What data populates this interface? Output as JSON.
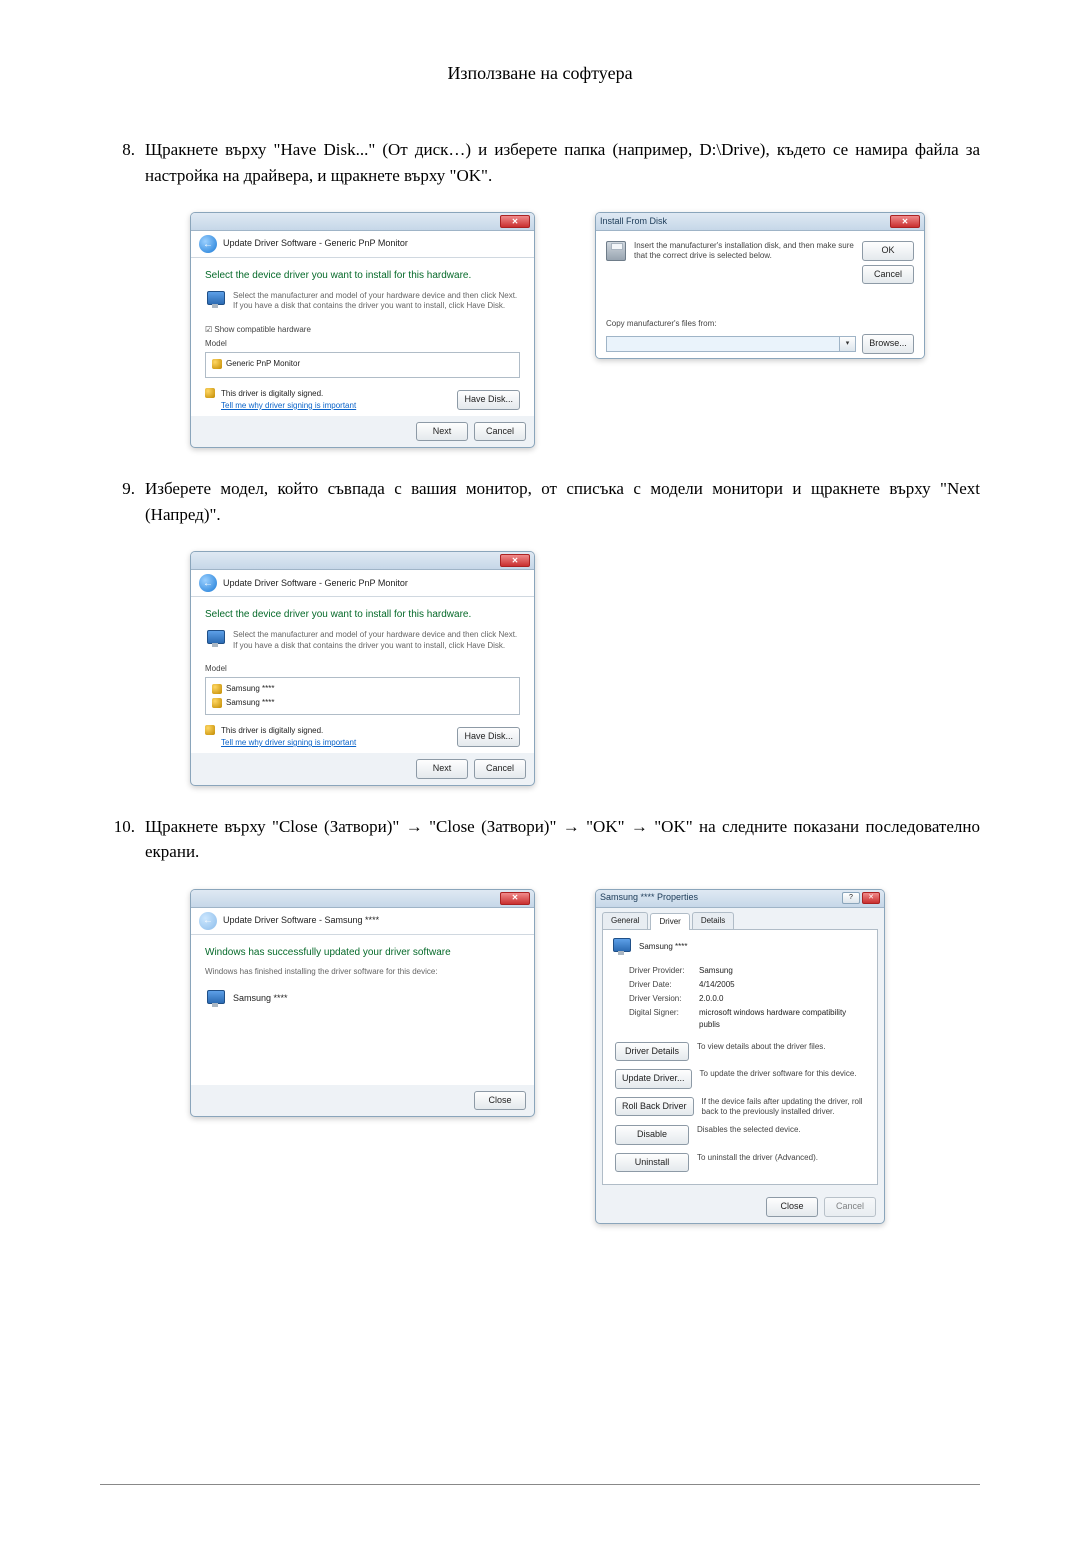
{
  "header": {
    "title": "Използване на софтуера"
  },
  "steps": {
    "s8": {
      "num": "8.",
      "text": "Щракнете върху \"Have Disk...\" (От диск…) и изберете папка (например, D:\\Drive), където се намира файла за настройка на драйвера, и щракнете върху \"OK\"."
    },
    "s9": {
      "num": "9.",
      "text": "Изберете модел, който съвпада с вашия монитор, от списъка с модели монитори и щракнете върху \"Next (Напред)\"."
    },
    "s10": {
      "num": "10.",
      "text": "Щракнете върху \"Close (Затвори)\" → \"Close (Затвори)\" → \"OK\" → \"OK\" на следните показани последователно екрани."
    }
  },
  "dlgA": {
    "breadcrumb": "Update Driver Software - Generic PnP Monitor",
    "heading": "Select the device driver you want to install for this hardware.",
    "info": "Select the manufacturer and model of your hardware device and then click Next. If you have a disk that contains the driver you want to install, click Have Disk.",
    "compat_label": "☑ Show compatible hardware",
    "list_label": "Model",
    "items": [
      "Generic PnP Monitor"
    ],
    "signed": "This driver is digitally signed.",
    "signed_link": "Tell me why driver signing is important",
    "have_disk": "Have Disk...",
    "next": "Next",
    "cancel": "Cancel"
  },
  "dlgB": {
    "title": "Install From Disk",
    "msg": "Insert the manufacturer's installation disk, and then make sure that the correct drive is selected below.",
    "ok": "OK",
    "cancel": "Cancel",
    "copy_label": "Copy manufacturer's files from:",
    "browse": "Browse..."
  },
  "dlgC": {
    "breadcrumb": "Update Driver Software - Generic PnP Monitor",
    "heading": "Select the device driver you want to install for this hardware.",
    "info": "Select the manufacturer and model of your hardware device and then click Next. If you have a disk that contains the driver you want to install, click Have Disk.",
    "list_label": "Model",
    "items": [
      "Samsung ****",
      "Samsung ****"
    ],
    "signed": "This driver is digitally signed.",
    "signed_link": "Tell me why driver signing is important",
    "have_disk": "Have Disk...",
    "next": "Next",
    "cancel": "Cancel"
  },
  "dlgD": {
    "breadcrumb": "Update Driver Software - Samsung ****",
    "heading": "Windows has successfully updated your driver software",
    "sub": "Windows has finished installing the driver software for this device:",
    "device": "Samsung ****",
    "close": "Close"
  },
  "dlgE": {
    "title": "Samsung **** Properties",
    "tabs": [
      "General",
      "Driver",
      "Details"
    ],
    "device": "Samsung ****",
    "provider_k": "Driver Provider:",
    "provider_v": "Samsung",
    "date_k": "Driver Date:",
    "date_v": "4/14/2005",
    "version_k": "Driver Version:",
    "version_v": "2.0.0.0",
    "signer_k": "Digital Signer:",
    "signer_v": "microsoft windows hardware compatibility publis",
    "btn_details": "Driver Details",
    "desc_details": "To view details about the driver files.",
    "btn_update": "Update Driver...",
    "desc_update": "To update the driver software for this device.",
    "btn_rollback": "Roll Back Driver",
    "desc_rollback": "If the device fails after updating the driver, roll back to the previously installed driver.",
    "btn_disable": "Disable",
    "desc_disable": "Disables the selected device.",
    "btn_uninstall": "Uninstall",
    "desc_uninstall": "To uninstall the driver (Advanced).",
    "close": "Close",
    "cancel": "Cancel"
  }
}
